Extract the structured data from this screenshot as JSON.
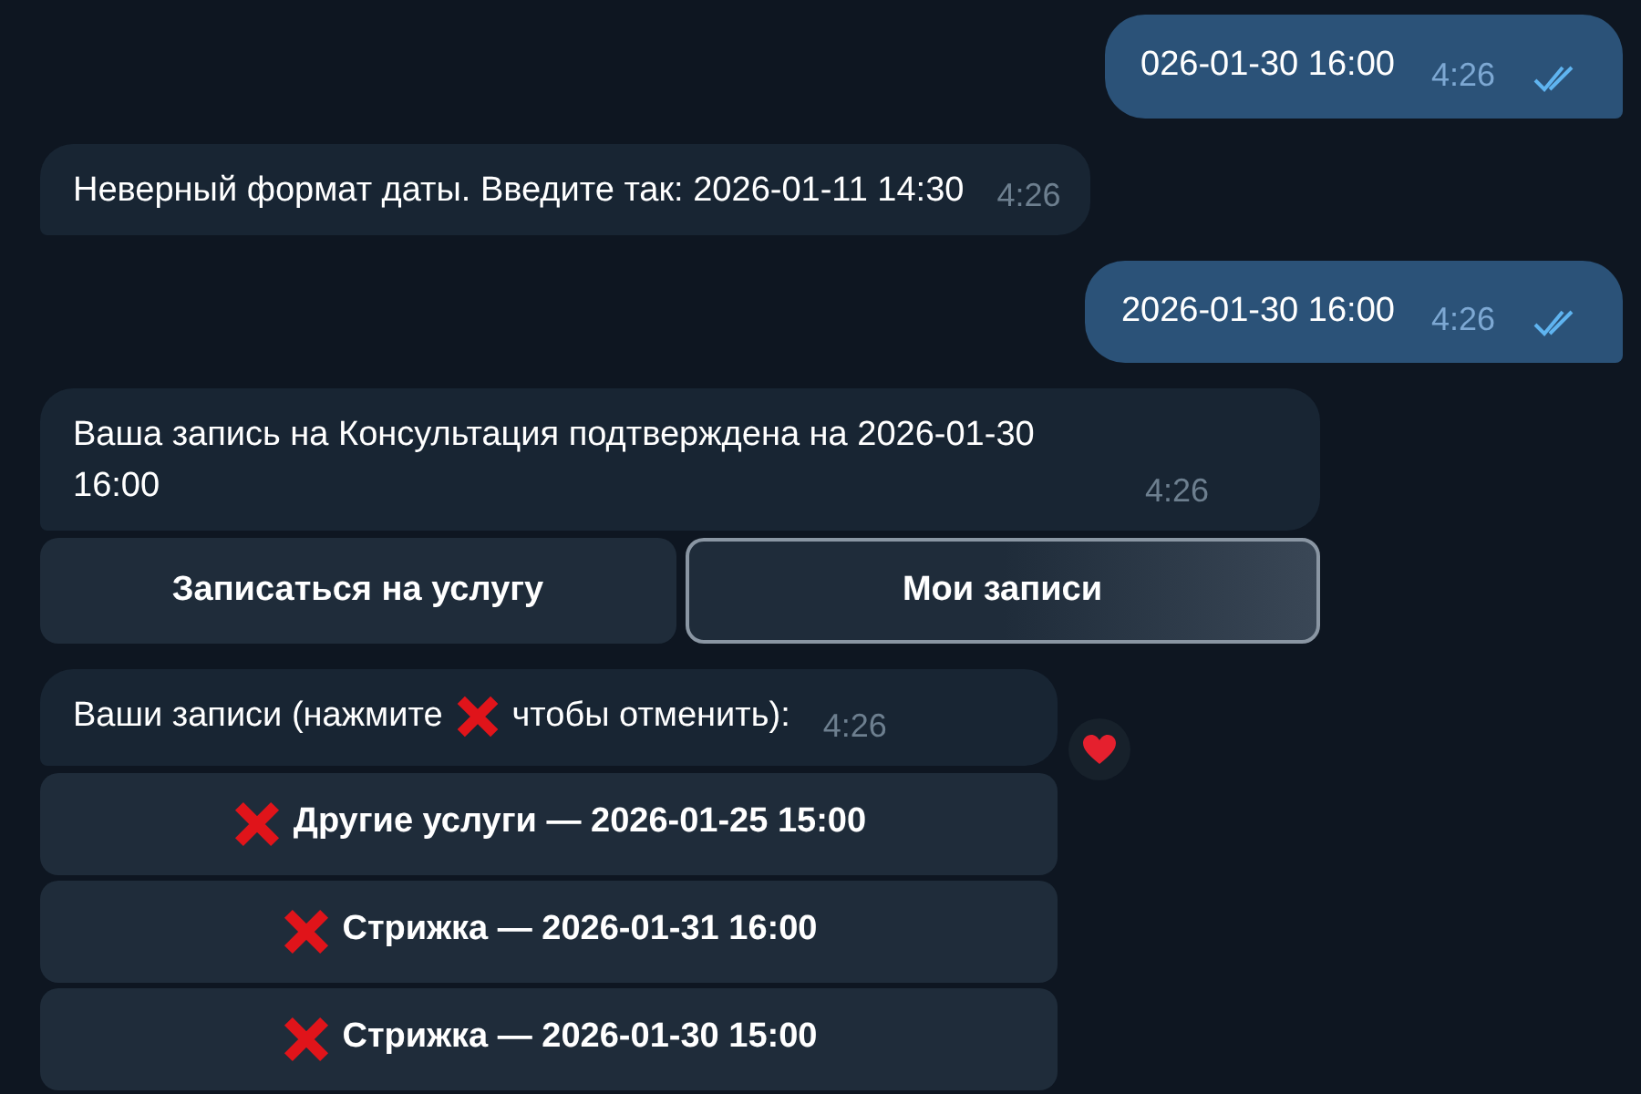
{
  "messages": [
    {
      "kind": "outgoing",
      "text": "026-01-30 16:00",
      "time": "4:26",
      "read": true
    },
    {
      "kind": "incoming",
      "text": "Неверный формат даты. Введите так: 2026-01-11 14:30",
      "time": "4:26"
    },
    {
      "kind": "outgoing",
      "text": "2026-01-30 16:00",
      "time": "4:26",
      "read": true
    },
    {
      "kind": "incoming",
      "text": "Ваша запись на Консультация подтверждена на 2026-01-30 16:00",
      "time": "4:26",
      "keyboard": [
        {
          "label": "Записаться на услугу",
          "highlighted": false
        },
        {
          "label": "Мои записи",
          "highlighted": true
        }
      ]
    },
    {
      "kind": "incoming",
      "text_before": "Ваши записи (нажмите",
      "text_after": "чтобы отменить):",
      "time": "4:26",
      "heart_reaction": true,
      "list": [
        {
          "label": "Другие услуги — 2026-01-25 15:00"
        },
        {
          "label": "Стрижка — 2026-01-31 16:00"
        },
        {
          "label": "Стрижка — 2026-01-30 15:00"
        }
      ]
    }
  ]
}
